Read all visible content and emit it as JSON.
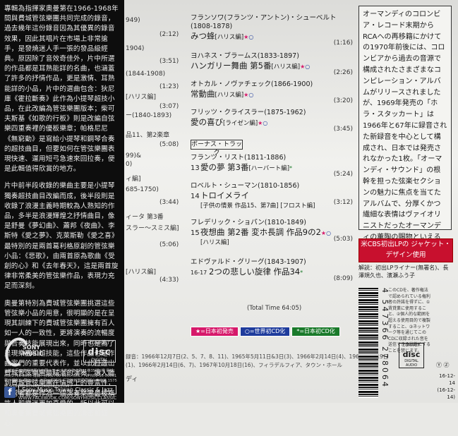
{
  "obi": {
    "paragraphs": [
      "專輯為指揮家奧曼第在1966-1968年間與費城管弦樂團共同完成的錄音，過去幾年這份錄音因為其優異的錄音效果，因此其唱片在市場上非常搶手，是發燒迷人手一張的發品級經典。原因除了音效奇佳外，片中所選的作品都是耳熟能詳的名曲，也涵蓋了許多的抒情作品，更是激情、耳熟能詳的小品，片中的選曲包含：狄尼庫《霍拉斷奏》此作為小提琴超技小品，在此改編為管弦樂團版本；柴可夫斯基《如歌的行板》則是改編自弦樂四重奏裡的優板樂章；帕格尼尼《無窮動》是寫給小提琴和鋼琴合奏的超技曲目，但要如何在管弦樂團表現快速、運用短弓急速來回拉奏，便是此輯值得欣賞的地方。",
      "片中前半段收錄的樂曲主要是小提琴獨奏超技曲目改編而成，後半段則是收錄了浪漫主義時期較為人熟知的作品，多半是浪漫輝煌之抒情曲目，像是舒曼《夢幻曲》、蕭邦《夜曲》、李斯特《愛之夢》、克萊斯勒《愛之喜》最特別的是兩首葛利格原創的管弦樂小品：《悲歌》，由兩首原為歌曲《受創的心》和《去年春天》，這是兩首旋律非常柔美的管弦樂作品，表現力充足而深刻。",
      "奧曼第特別為費城管弦樂團挑選這些管弦樂小品的用意，很明顯的是在呈現其訓練下的費城管弦樂團擁有百人如一人的一致性，更將演奏的流暢度與合奏技能展現出來，同時也是為了呈現樂團和超技能，這些作品也是作曲家們的重要代表作，並以此打造出費城管弦樂團最精湛的演奏，讓人聽到費城管弦樂團在情感上的豐富性，這兩者都是作為一個演奏樂團最被稱許人和樂迷更加喜愛的，所以此可以和奧曼第費城管弦樂團的濃密和細心。"
    ],
    "brand": "SONY MUSIC",
    "cd_logo_top": "COMPACT",
    "cd_logo_main": "disc",
    "cd_logo_bottom": "DIGITAL AUDIO",
    "address": "台灣索尼音樂娛樂股份有限公司 台北市光復北路11巷35號5樓 電話：(02)2766-8600 傳真：(02)2766-8600 ISRC: TW-N01-16-00061 著作權所有·翻印必究·不得公開播放 行政院新聞局局版台音字第 1575 號 SONYMUSICMASTERWORKS.COM / WWW.SONYMUSIC.COM.TW",
    "fb_label": "Sony Music Taiwan Classic & Jazz",
    "fb_url": "WWW.FACEBOOK.COM/SONYMUSICCLASSIC"
  },
  "left_col": [
    {
      "text": "949)"
    },
    {
      "text": "(2:12)"
    },
    {
      "text": "1904)"
    },
    {
      "text": "(3:51)"
    },
    {
      "text": "(1844-1908)"
    },
    {
      "text": "(1:23)"
    },
    {
      "text": "[ハリス編]"
    },
    {
      "text": "(3:07)"
    },
    {
      "text": "ー(1840-1893)"
    },
    {
      "text": "品11、第2楽章"
    },
    {
      "text": "(5:08)"
    },
    {
      "text": "99)&"
    },
    {
      "text": "0)"
    },
    {
      "text": "ィ編]"
    },
    {
      "text": "685-1750)"
    },
    {
      "text": "(3:44)"
    },
    {
      "text": "ィータ 第3番"
    },
    {
      "text": "スラー～スミス編]"
    },
    {
      "text": "(5:06)"
    },
    {
      "text": "[ハリス編]"
    },
    {
      "text": "(4:33)"
    },
    {
      "text": "ディ"
    }
  ],
  "tracks": [
    {
      "num": "",
      "composer": "フランソワ(フランツ・アントン)・シューベルト",
      "composer2": "(1808-1878)",
      "title": "みつ蜂",
      "arr": "[ハリス編]",
      "dur": "(1:16)"
    },
    {
      "num": "",
      "composer": "ヨハネス・ブラームス(1833-1897)",
      "title": "ハンガリー舞曲 第5番",
      "arr": "[ハリス編]",
      "dur": "(2:26)"
    },
    {
      "num": "",
      "composer": "オトカル・ノヴァチェック(1866-1900)",
      "title": "常動曲",
      "arr": "[ハリス編]",
      "dur": "(3:20)"
    },
    {
      "num": "",
      "composer": "フリッツ・クライスラー(1875-1962)",
      "title": "愛の喜び",
      "arr": "[ライゼン編]",
      "dur": "(3:45)"
    },
    {
      "num": "13",
      "composer": "フランツ・リスト(1811-1886)",
      "title": "愛の夢 第3番",
      "arr": "[ハーバート編]",
      "dur": "(5:24)"
    },
    {
      "num": "14",
      "composer": "ロベルト・シューマン(1810-1856)",
      "title": "トロイメライ",
      "arr": "[子供の情景 作品15、第7曲] [フロスト編]",
      "dur": "(3:12)"
    },
    {
      "num": "15",
      "composer": "フレデリック・ショパン(1810-1849)",
      "title": "夜想曲 第2番 変ホ長調 作品9の2",
      "arr": "[ハリス編]",
      "dur": "(5:03)"
    },
    {
      "num": "16-17",
      "composer": "エドヴァルド・グリーグ(1843-1907)",
      "title": "2つの悲しい旋律 作品34",
      "arr": "",
      "dur": "(8:09)"
    }
  ],
  "bonus_label": "ボーナス・トラック",
  "total_time": "(Total Time 64:05)",
  "legend": [
    {
      "label": "★=日本初発売",
      "color": "#d6196a"
    },
    {
      "label": "○=世界初CD化",
      "color": "#1f3c9c"
    },
    {
      "label": "*=日本初CD化",
      "color": "#1a7a2a"
    }
  ],
  "credit_lines": [
    "録音：1966年12月7日(2、5、7、8、11)、1965年5月11日&3日(3)、1966年2月14日(4)、1968年5月19日",
    "(1)、1966年2月14日(6、7)、1967年10月18日(16)、フィラデルフィア、タウン・ホール"
  ],
  "right": {
    "description": "オーマンディのコロンビア・レコード末期からRCAへの再移籍にかけての1970年前後には、コロンビアから過去の音源で構成されたさまざまなコンピレーション・アルバムがリリースされましたが、1969年発売の「ホラ・スタッカート」は1966年と67年に録音された新録音を中心として構成され、日本では発売されなかった1枚。「オーマンディ・サウンド」の根幹を担った弦楽セクションの魅力に焦点を当てたアルバムで、分厚くかつ繊細な表情はヴァイオリニストだったオーマンディの薫陶の賜物といえるでしょう。",
    "red_box": "米CBS初出LPの ジャケット・デザイン使用",
    "liner": "解説：初出LPライナー(無署名)、長澤規久也、濱瀬ふう子",
    "barcode_number": "4 547366 278064",
    "notice": "このCDを、著作権法で認められている権利者の許諾を得ずに、①賃貸業に使用すること、②個人的な範囲を超える使用目的で複製すること、③ネットワーク等を通じてこのCDに収録された音を送信できる状態にすることを禁じます。",
    "cd_logo_top": "COMPACT",
    "cd_logo_main": "disc",
    "cd_logo_bottom": "DIGITAL AUDIO",
    "codes": [
      "16-12-14",
      "(16-12-14)"
    ],
    "yz": "Ⓨ Ⓩ"
  }
}
